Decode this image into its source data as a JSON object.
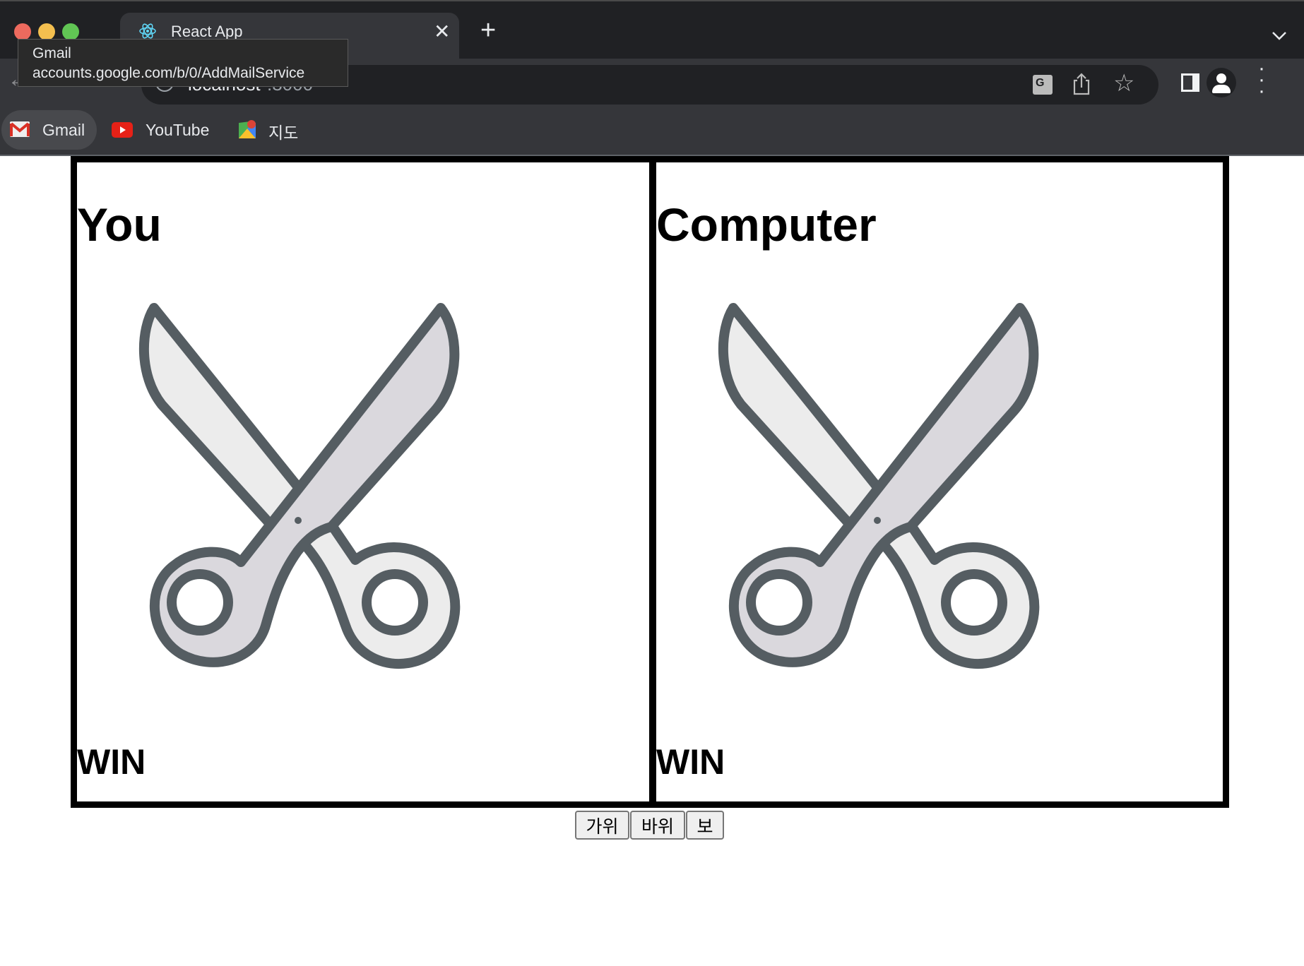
{
  "browser": {
    "tab_title": "React App",
    "url_host": "localhost",
    "url_port": ":3000",
    "tooltip": {
      "title": "Gmail",
      "url": "accounts.google.com/b/0/AddMailService"
    },
    "bookmarks": [
      {
        "label": "Gmail",
        "icon": "gmail-icon"
      },
      {
        "label": "YouTube",
        "icon": "youtube-icon"
      },
      {
        "label": "지도",
        "icon": "maps-icon"
      }
    ]
  },
  "game": {
    "player": {
      "title": "You",
      "choice": "scissors",
      "result": "WIN"
    },
    "computer": {
      "title": "Computer",
      "choice": "scissors",
      "result": "WIN"
    },
    "buttons": [
      "가위",
      "바위",
      "보"
    ]
  },
  "colors": {
    "scissors_outline": "#555d62",
    "blade_light": "#ececec",
    "blade_dark": "#dad8dd"
  }
}
